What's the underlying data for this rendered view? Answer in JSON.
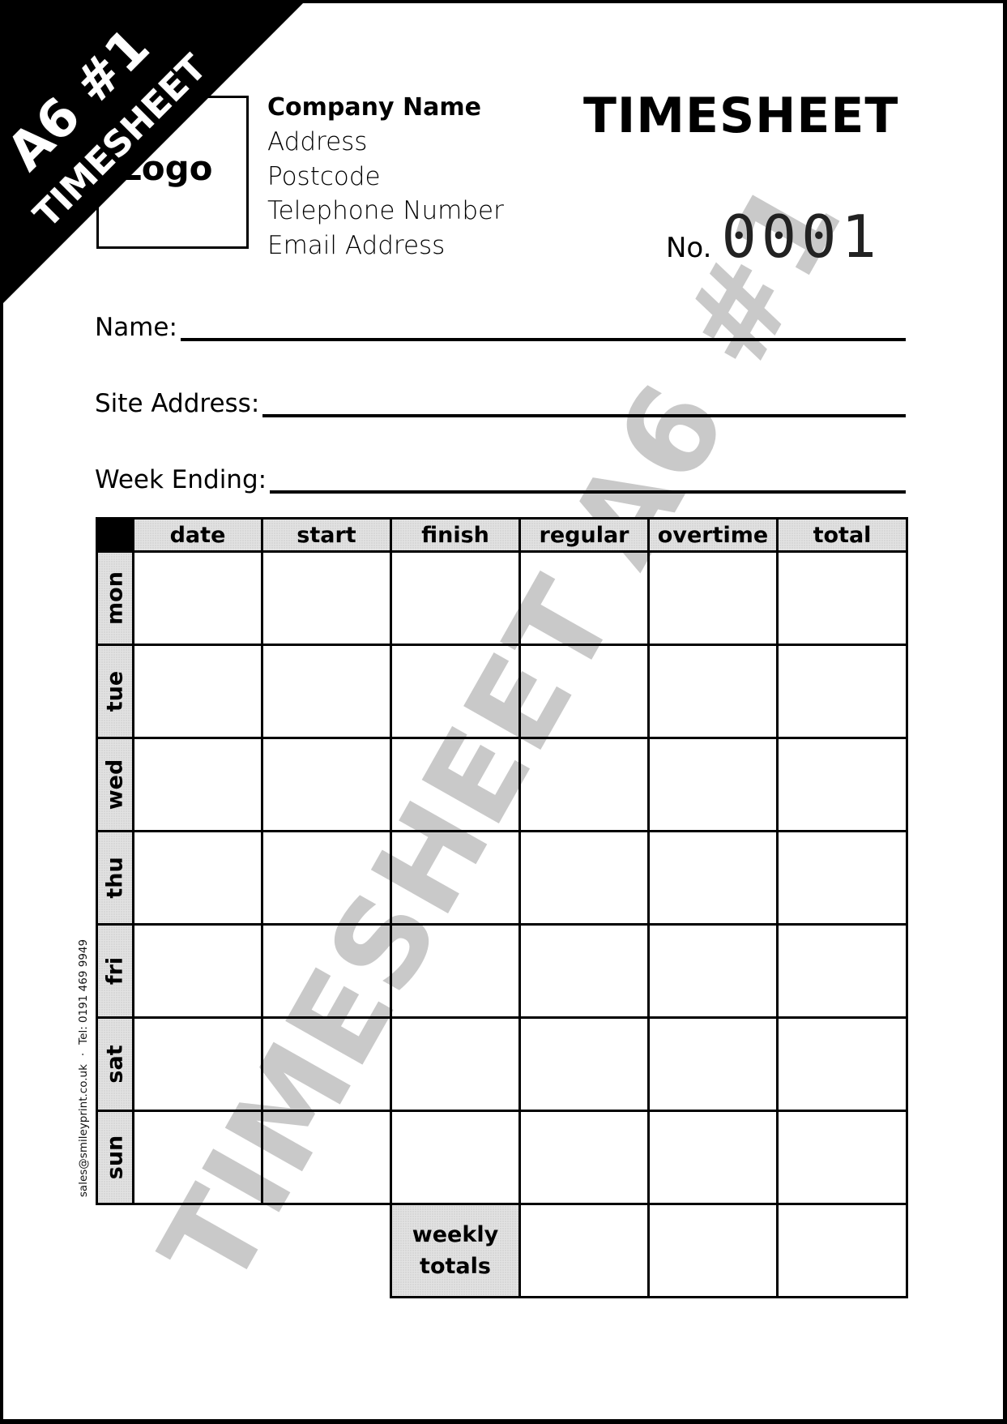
{
  "corner_banner": {
    "line1": "A6 #1",
    "line2": "TIMESHEET",
    "background": "#000000",
    "text_color": "#ffffff"
  },
  "logo": {
    "label": "Logo"
  },
  "company": {
    "name": "Company Name",
    "address": "Address",
    "postcode": "Postcode",
    "telephone": "Telephone Number",
    "email": "Email Address"
  },
  "document": {
    "title": "TIMESHEET",
    "number_prefix": "No.",
    "number": "0001"
  },
  "fields": {
    "name_label": "Name:",
    "name_value": "",
    "site_address_label": "Site Address:",
    "site_address_value": "",
    "week_ending_label": "Week Ending:",
    "week_ending_value": ""
  },
  "table": {
    "columns": [
      "date",
      "start",
      "finish",
      "regular",
      "overtime",
      "total"
    ],
    "rows": [
      {
        "day": "mon",
        "cells": [
          "",
          "",
          "",
          "",
          "",
          ""
        ]
      },
      {
        "day": "tue",
        "cells": [
          "",
          "",
          "",
          "",
          "",
          ""
        ]
      },
      {
        "day": "wed",
        "cells": [
          "",
          "",
          "",
          "",
          "",
          ""
        ]
      },
      {
        "day": "thu",
        "cells": [
          "",
          "",
          "",
          "",
          "",
          ""
        ]
      },
      {
        "day": "fri",
        "cells": [
          "",
          "",
          "",
          "",
          "",
          ""
        ]
      },
      {
        "day": "sat",
        "cells": [
          "",
          "",
          "",
          "",
          "",
          ""
        ]
      },
      {
        "day": "sun",
        "cells": [
          "",
          "",
          "",
          "",
          "",
          ""
        ]
      }
    ],
    "weekly_totals": {
      "label_line1": "weekly",
      "label_line2": "totals",
      "regular": "",
      "overtime": "",
      "total": ""
    }
  },
  "watermark": {
    "text": "TIMESHEET A6 #1",
    "color": "#c9c9c9"
  },
  "footer": {
    "email": "sales@smileyprint.co.uk",
    "separator": "·",
    "phone": "Tel: 0191 469 9949"
  }
}
